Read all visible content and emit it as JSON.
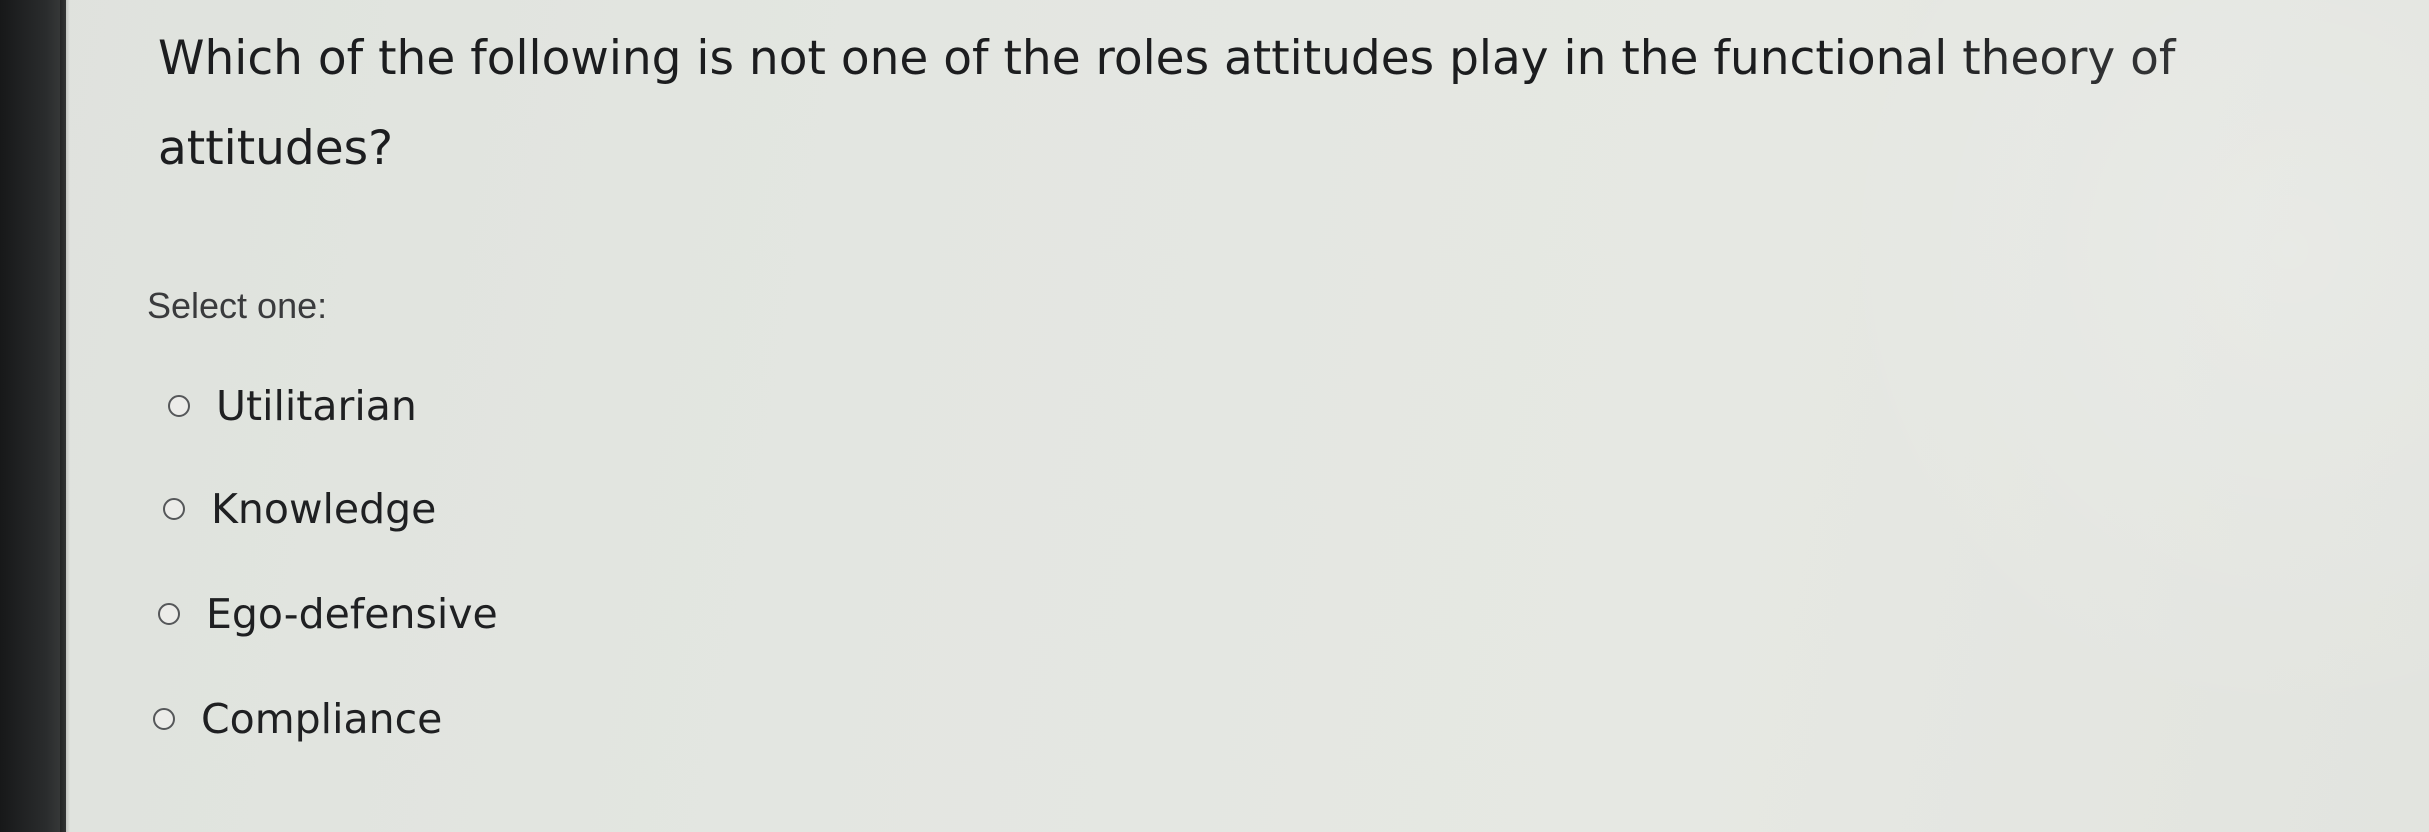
{
  "question": {
    "text": "Which of the following is not one of the roles attitudes play in the functional theory of attitudes?"
  },
  "prompt": {
    "text": "Select one:"
  },
  "options": [
    {
      "label": "Utilitarian",
      "selected": false
    },
    {
      "label": "Knowledge",
      "selected": false
    },
    {
      "label": "Ego-defensive",
      "selected": false
    },
    {
      "label": "Compliance",
      "selected": false
    }
  ],
  "colors": {
    "page_background": "#e3e6e1",
    "text": "#1c1d1f",
    "bezel": "#1d1e1f"
  }
}
